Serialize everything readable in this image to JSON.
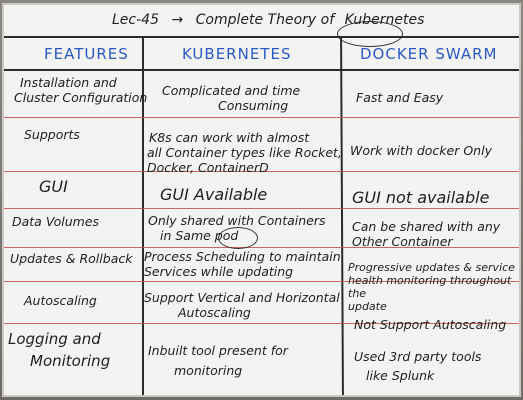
{
  "board": {
    "title_lec": "Lec-45",
    "title_arrow": "→",
    "title_text": "Complete Theory of",
    "title_highlight": "Kubernetes"
  },
  "table": {
    "headers": [
      "FEATURES",
      "KUBERNETES",
      "DOCKER SWARM"
    ],
    "rows": [
      {
        "feature": [
          "Installation and",
          "Cluster Configuration"
        ],
        "kubernetes": [
          "Complicated and time",
          "Consuming"
        ],
        "swarm": [
          "Fast and Easy"
        ]
      },
      {
        "feature": [
          "Supports"
        ],
        "kubernetes": [
          "K8s can work with almost",
          "all Container types like Rocket,",
          "Docker, ContainerD"
        ],
        "swarm": [
          "Work with docker Only"
        ]
      },
      {
        "feature": [
          "GUI"
        ],
        "kubernetes": [
          "GUI Available"
        ],
        "swarm": [
          "GUI not available"
        ]
      },
      {
        "feature": [
          "Data Volumes"
        ],
        "kubernetes": [
          "Only shared with Containers",
          "in Same pod"
        ],
        "swarm": [
          "Can be shared with any",
          "Other Container"
        ]
      },
      {
        "feature": [
          "Updates & Rollback"
        ],
        "kubernetes": [
          "Process Scheduling to maintain",
          "Services while updating"
        ],
        "swarm": [
          "Progressive updates & service",
          "health monitoring throughout the",
          "update"
        ]
      },
      {
        "feature": [
          "Autoscaling"
        ],
        "kubernetes": [
          "Support Vertical and Horizontal",
          "Autoscaling"
        ],
        "swarm": [
          "Not Support Autoscaling"
        ]
      },
      {
        "feature": [
          "Logging and",
          "Monitoring"
        ],
        "kubernetes": [
          "Inbuilt tool present for",
          "monitoring"
        ],
        "swarm": [
          "Used 3rd party tools",
          "like Splunk"
        ]
      }
    ]
  },
  "colors": {
    "header_blue": "#2b59c3",
    "marker_black": "#1f1f1f",
    "row_red": "#c44a4a"
  }
}
